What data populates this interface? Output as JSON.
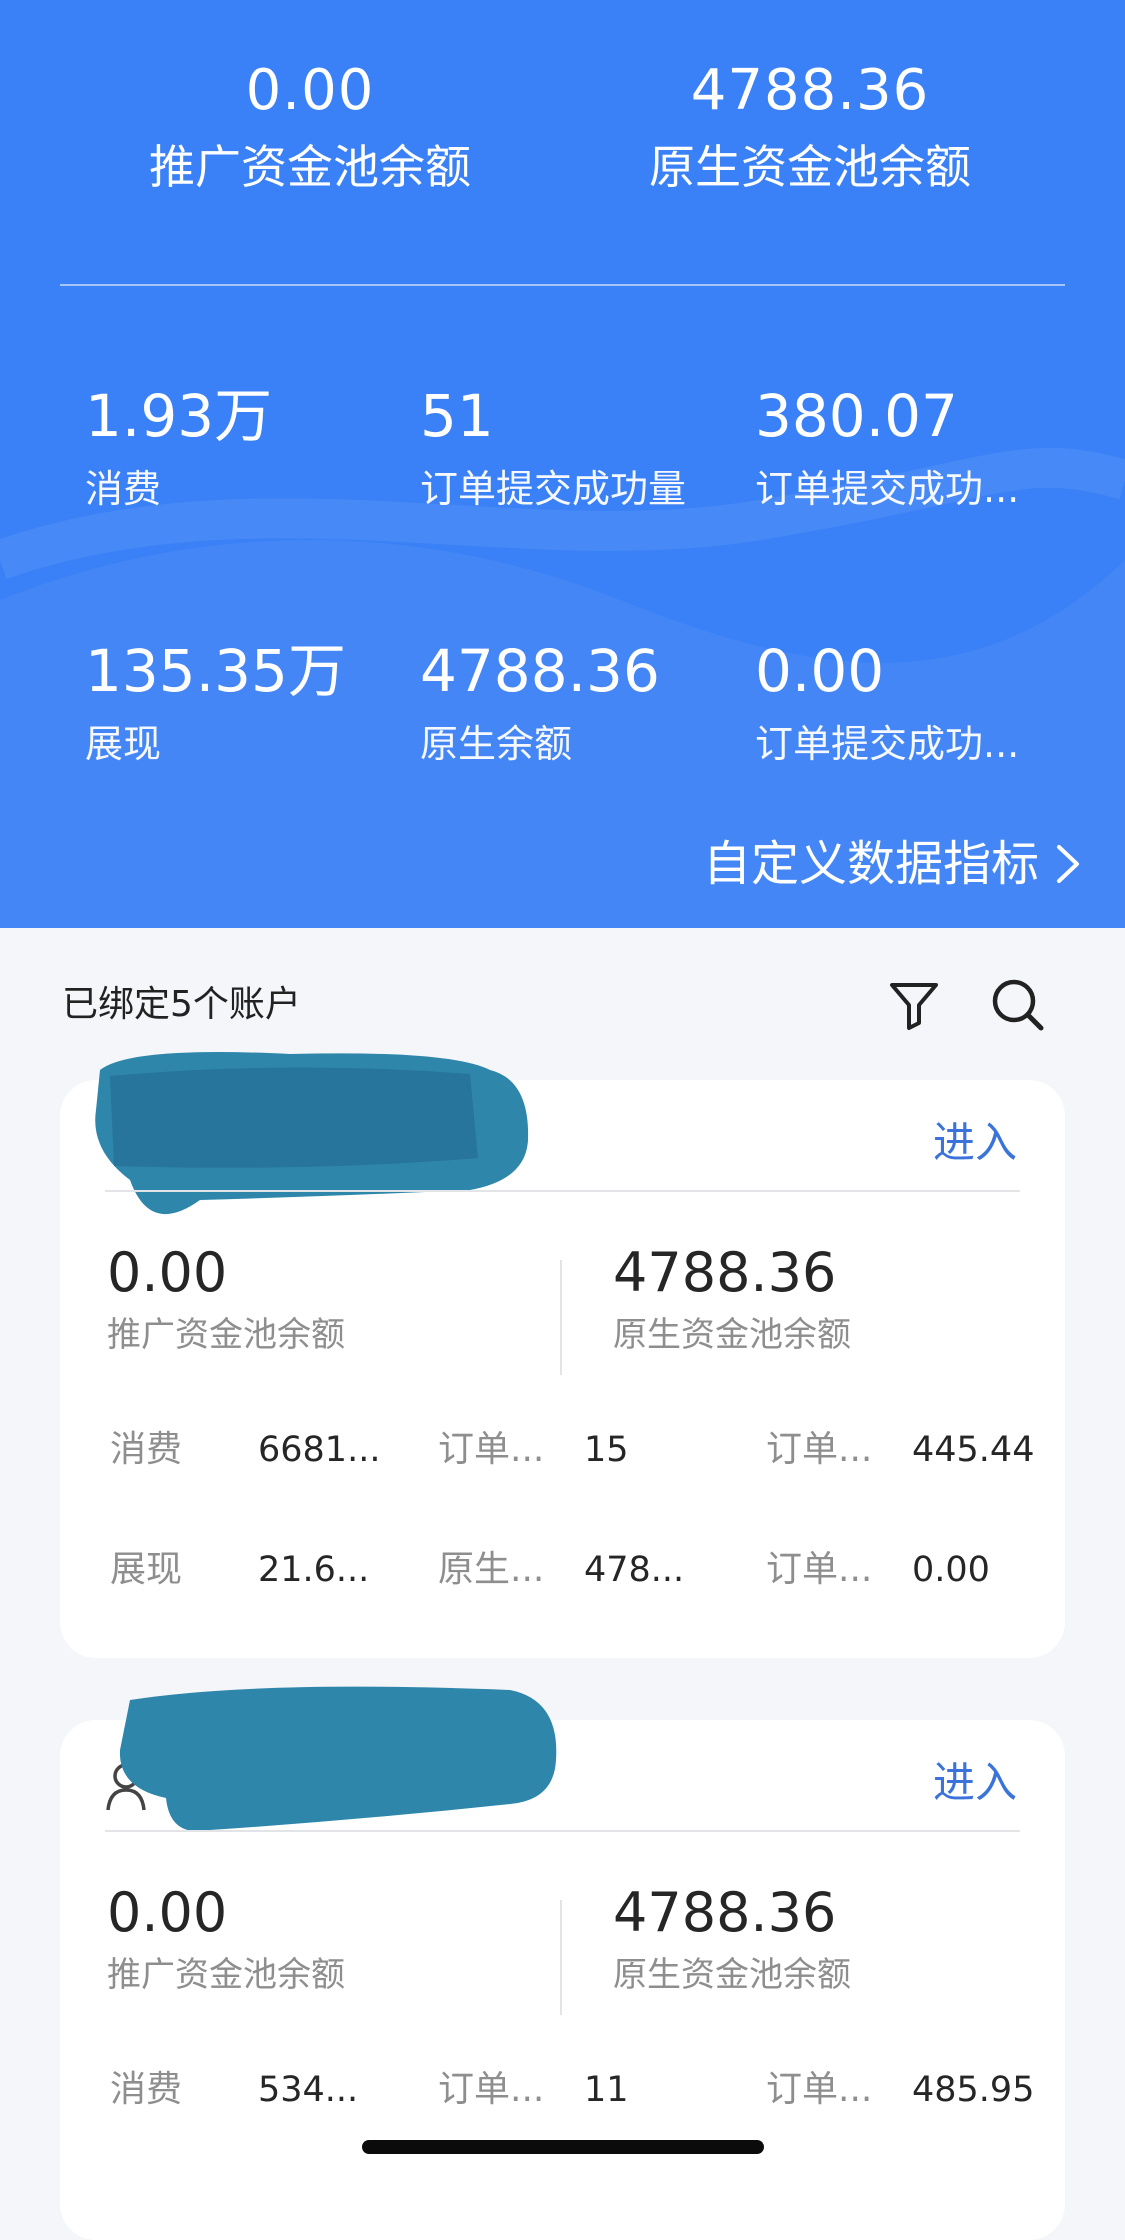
{
  "summary": {
    "promo_pool_value": "0.00",
    "promo_pool_label": "推广资金池余额",
    "native_pool_value": "4788.36",
    "native_pool_label": "原生资金池余额"
  },
  "metrics": [
    {
      "value": "1.93万",
      "label": "消费"
    },
    {
      "value": "51",
      "label": "订单提交成功量"
    },
    {
      "value": "380.07",
      "label": "订单提交成功..."
    },
    {
      "value": "135.35万",
      "label": "展现"
    },
    {
      "value": "4788.36",
      "label": "原生余额"
    },
    {
      "value": "0.00",
      "label": "订单提交成功..."
    }
  ],
  "customize_label": "自定义数据指标",
  "list": {
    "title": "已绑定5个账户"
  },
  "accounts": [
    {
      "enter_label": "进入",
      "promo_pool_value": "0.00",
      "promo_pool_label": "推广资金池余额",
      "native_pool_value": "4788.36",
      "native_pool_label": "原生资金池余额",
      "rows": [
        [
          {
            "label": "消费",
            "value": "6681..."
          },
          {
            "label": "订单...",
            "value": "15"
          },
          {
            "label": "订单...",
            "value": "445.44"
          }
        ],
        [
          {
            "label": "展现",
            "value": "21.6..."
          },
          {
            "label": "原生...",
            "value": "478..."
          },
          {
            "label": "订单...",
            "value": "0.00"
          }
        ]
      ]
    },
    {
      "enter_label": "进入",
      "promo_pool_value": "0.00",
      "promo_pool_label": "推广资金池余额",
      "native_pool_value": "4788.36",
      "native_pool_label": "原生资金池余额",
      "rows": [
        [
          {
            "label": "消费",
            "value": "534..."
          },
          {
            "label": "订单...",
            "value": "11"
          },
          {
            "label": "订单...",
            "value": "485.95"
          }
        ]
      ]
    }
  ],
  "colors": {
    "hero_blue": "#3a80f6",
    "link_blue": "#3a73d9",
    "redaction": "#2f86ab"
  },
  "icons": [
    "chevron-right-icon",
    "filter-icon",
    "search-icon",
    "user-icon"
  ]
}
